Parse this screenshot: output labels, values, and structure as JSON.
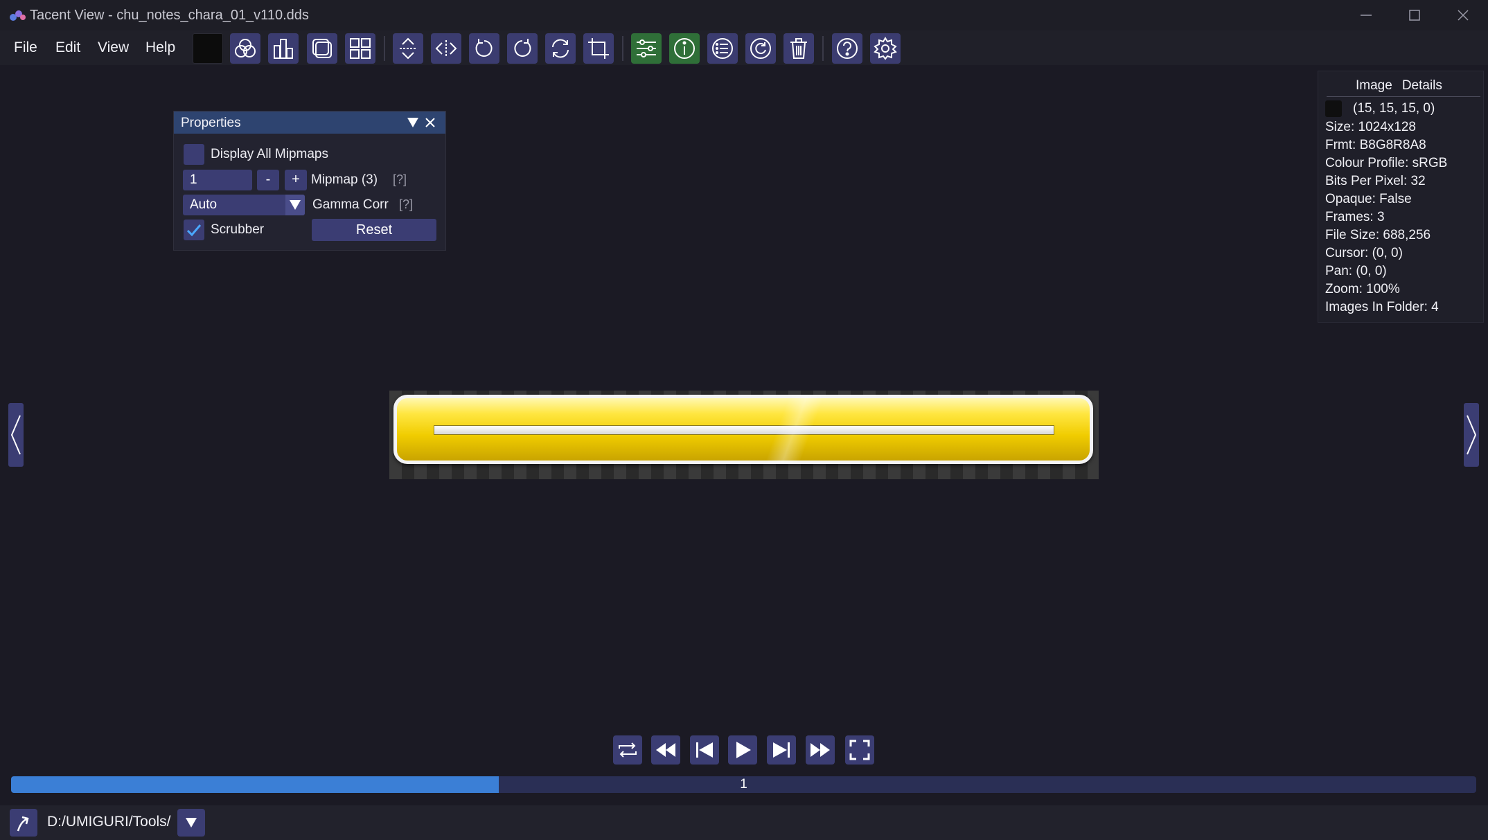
{
  "window": {
    "title": "Tacent View - chu_notes_chara_01_v110.dds"
  },
  "menu": {
    "file": "File",
    "edit": "Edit",
    "view": "View",
    "help": "Help"
  },
  "toolbar": {
    "icons": [
      "color-swatch",
      "channels-icon",
      "histogram-icon",
      "tile-icon",
      "grid-icon",
      "flip-vertical-icon",
      "flip-horizontal-icon",
      "rotate-ccw-icon",
      "rotate-cw-icon",
      "rotate-any-icon",
      "crop-icon",
      "properties-icon",
      "info-icon",
      "list-icon",
      "refresh-icon",
      "delete-icon",
      "help-icon",
      "settings-icon"
    ]
  },
  "properties": {
    "title": "Properties",
    "display_all_mipmaps": "Display All Mipmaps",
    "mipmap_value": "1",
    "minus": "-",
    "plus": "+",
    "mipmap_label": "Mipmap (3)",
    "help": "[?]",
    "gamma_value": "Auto",
    "gamma_label": "Gamma Corr",
    "scrubber_label": "Scrubber",
    "reset": "Reset"
  },
  "details": {
    "tab_image": "Image",
    "tab_details": "Details",
    "pixel": "(15, 15, 15, 0)",
    "lines": [
      "Size: 1024x128",
      "Frmt: B8G8R8A8",
      "Colour Profile: sRGB",
      "Bits Per Pixel: 32",
      "Opaque: False",
      "Frames: 3",
      "File Size: 688,256",
      "Cursor: (0, 0)",
      "Pan: (0, 0)",
      "Zoom: 100%",
      "Images In Folder: 4"
    ]
  },
  "scrubber": {
    "label": "1",
    "progress": 0.333
  },
  "footer": {
    "path": "D:/UMIGURI/Tools/"
  },
  "colors": {
    "accent": "#3b3d73",
    "scrub_fill": "#3b7fd6",
    "green": "#2f6f38"
  }
}
